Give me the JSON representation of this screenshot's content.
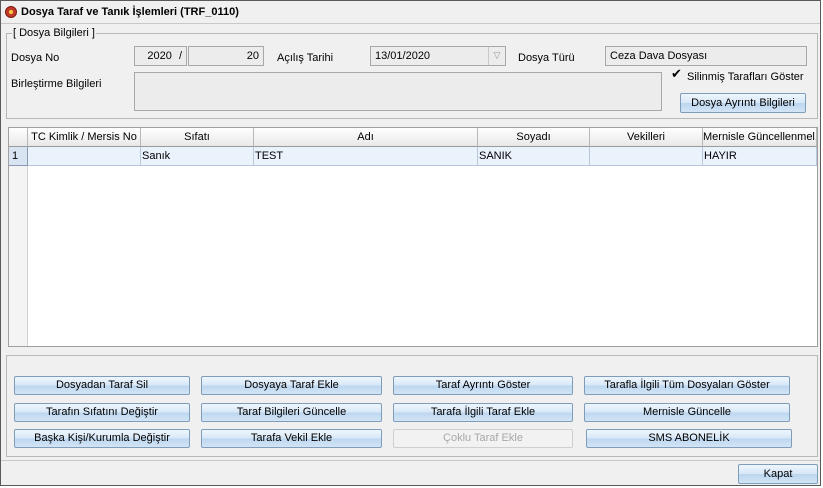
{
  "window": {
    "title": "Dosya Taraf ve Tanık İşlemleri (TRF_0110)"
  },
  "dosya_bilgileri": {
    "legend": "[ Dosya Bilgileri ]",
    "dosya_no_label": "Dosya No",
    "dosya_yil": "2020",
    "dosya_sep": "/",
    "dosya_sira": "20",
    "acilis_tarihi_label": "Açılış Tarihi",
    "acilis_tarihi": "13/01/2020",
    "dosya_turu_label": "Dosya Türü",
    "dosya_turu": "Ceza Dava Dosyası",
    "birlestirme_label": "Birleştirme Bilgileri",
    "birlestirme_value": "",
    "silinmis_label": "Silinmiş Tarafları Göster",
    "silinmis_checked": true,
    "ayrinti_button": "Dosya Ayrıntı Bilgileri"
  },
  "grid": {
    "columns": [
      "TC Kimlik / Mersis No",
      "Sıfatı",
      "Adı",
      "Soyadı",
      "Vekilleri",
      "Mernisle Güncellenmel..."
    ],
    "rows": [
      {
        "num": "1",
        "cells": [
          "",
          "Sanık",
          "TEST",
          "SANIK",
          "",
          "HAYIR"
        ]
      }
    ]
  },
  "buttons": {
    "row1": [
      "Dosyadan Taraf Sil",
      "Dosyaya Taraf Ekle",
      "Taraf Ayrıntı Göster",
      "Tarafla İlgili Tüm Dosyaları Göster"
    ],
    "row2": [
      "Tarafın Sıfatını Değiştir",
      "Taraf Bilgileri  Güncelle",
      "Tarafa İlgili Taraf Ekle",
      "Mernisle Güncelle"
    ],
    "row3": [
      "Başka Kişi/Kurumla Değiştir",
      "Tarafa Vekil Ekle",
      "Çoklu Taraf Ekle",
      "SMS ABONELİK"
    ],
    "kapat": "Kapat"
  },
  "icons": {
    "app": "app-logo-icon",
    "combo": "chevron-down-icon",
    "check": "checkmark-icon"
  }
}
